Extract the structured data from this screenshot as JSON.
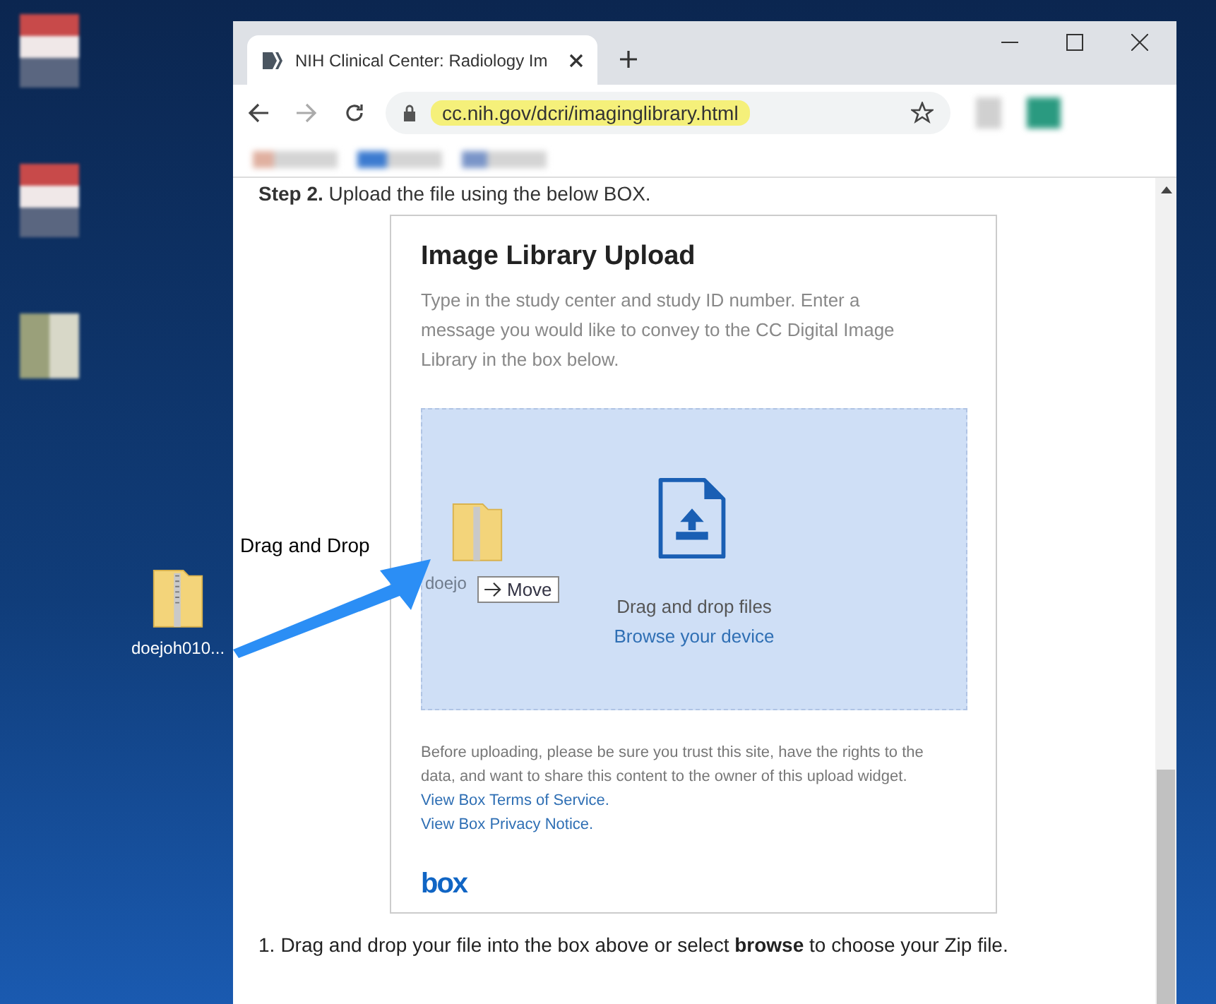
{
  "desktop": {
    "file_label": "doejoh010..."
  },
  "annotation": {
    "label": "Drag and Drop"
  },
  "browser": {
    "tab_title": "NIH Clinical Center: Radiology Im",
    "url": "cc.nih.gov/dcri/imaginglibrary.html"
  },
  "page": {
    "step": "**Step 2.** Upload the file using the below BOX.",
    "widget": {
      "title": "Image Library Upload",
      "description": "Type in the study center and study ID number. Enter a message you would like to convey to the CC Digital Image Library in the box below.",
      "drop_zone": {
        "drag_label": "doejo",
        "drag_action": "Move",
        "prompt": "Drag and drop files",
        "browse_link": "Browse your device"
      },
      "notice": "Before uploading, please be sure you trust this site, have the rights to the data, and want to share this content to the owner of this upload widget.",
      "links": [
        "View Box Terms of Service.",
        "View Box Privacy Notice."
      ],
      "logo": "box"
    },
    "instructions": [
      {
        "number": "1.",
        "text": "Drag and drop your file into the box above or select **browse** to choose your Zip file."
      }
    ]
  }
}
